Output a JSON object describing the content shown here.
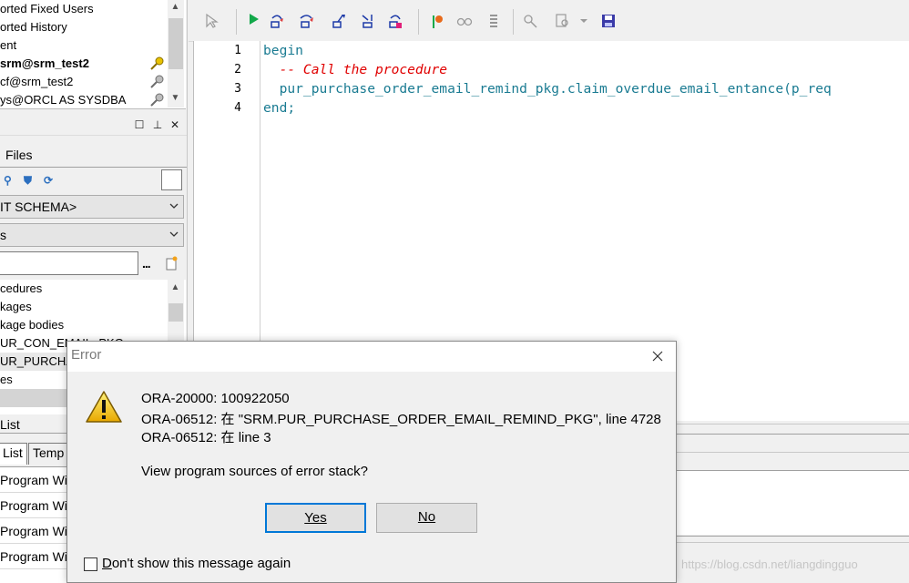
{
  "connections": [
    {
      "label": "orted Fixed Users",
      "bold": false
    },
    {
      "label": "orted History",
      "bold": false
    },
    {
      "label": "ent",
      "bold": false
    },
    {
      "label": "srm@srm_test2",
      "bold": true
    },
    {
      "label": "cf@srm_test2",
      "bold": false
    },
    {
      "label": "ys@ORCL AS SYSDBA",
      "bold": false
    }
  ],
  "files_tab": "Files",
  "schema_combo": "IT SCHEMA>",
  "type_combo": "s",
  "filter_ellipsis": "...",
  "objects": [
    "cedures",
    "kages",
    "kage bodies",
    "UR_CON_EMAIL_PKG",
    "UR_PURCHA",
    "es",
    ""
  ],
  "list_tab": "List",
  "bottom_tabs": [
    "List",
    "Temp"
  ],
  "windows": [
    "Program Wi",
    "Program Wi",
    "Program Wi",
    "Program Wi"
  ],
  "editor": {
    "line_numbers": [
      "1",
      "2",
      "3",
      "4"
    ],
    "lines": [
      {
        "text": "begin",
        "cls": "kw"
      },
      {
        "text": "  -- Call the procedure",
        "cls": "cm"
      },
      {
        "text": "  pur_purchase_order_email_remind_pkg.claim_overdue_email_entance(p_req",
        "cls": "tx"
      },
      {
        "text": "end;",
        "cls": "kw"
      }
    ]
  },
  "watermark": "https://blog.csdn.net/liangdingguo",
  "dialog": {
    "title": "Error",
    "messages": [
      "ORA-20000: 100922050",
      "ORA-06512: 在 \"SRM.PUR_PURCHASE_ORDER_EMAIL_REMIND_PKG\", line 4728",
      "ORA-06512: 在 line 3"
    ],
    "question": "View program sources of error stack?",
    "yes_label": "Yes",
    "no_label": "No",
    "dont_show_first": "D",
    "dont_show_rest": "on't show this message again",
    "dont_show_checked": false
  },
  "colors": {
    "keyword": "#1a7b92",
    "comment": "#e00000",
    "accent": "#0078d7"
  }
}
